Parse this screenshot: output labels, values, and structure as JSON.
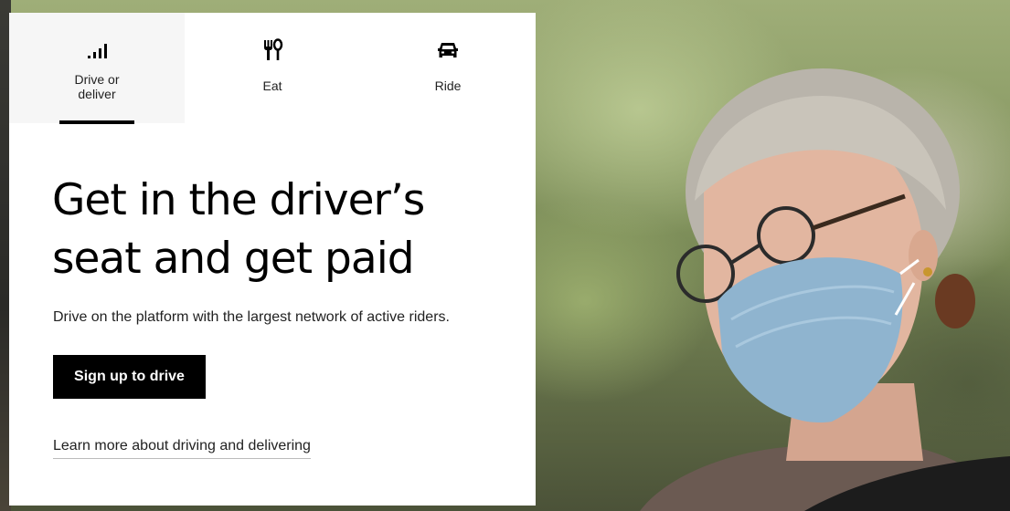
{
  "tabs": [
    {
      "label": "Drive or deliver",
      "icon": "signal-bars-icon",
      "active": true
    },
    {
      "label": "Eat",
      "icon": "fork-knife-icon",
      "active": false
    },
    {
      "label": "Ride",
      "icon": "car-icon",
      "active": false
    }
  ],
  "hero": {
    "headline_line1": "Get in the driver’s",
    "headline_line2": "seat and get paid",
    "subtext": "Drive on the platform with the largest network of active riders.",
    "cta_label": "Sign up to drive",
    "learn_more_label": "Learn more about driving and delivering"
  }
}
